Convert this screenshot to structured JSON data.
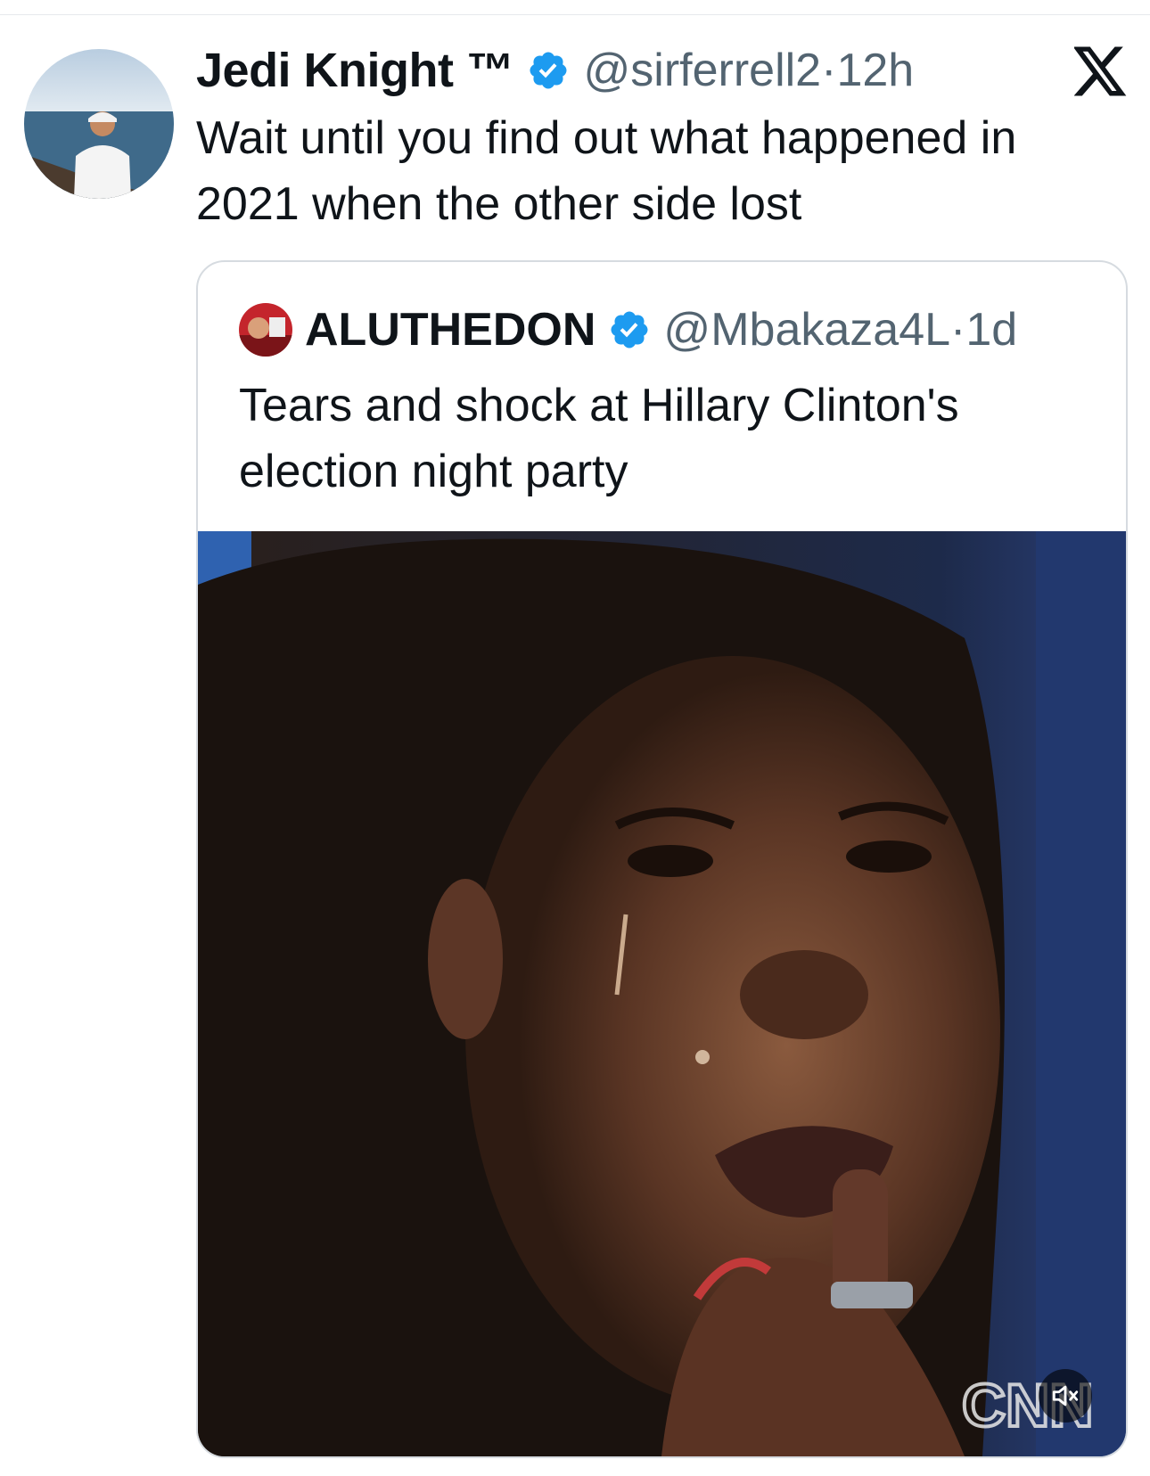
{
  "tweet": {
    "author_name": "Jedi Knight ™",
    "handle": "@sirferrell2",
    "separator": "·",
    "time": "12h",
    "text": "Wait until you find out what happened in 2021 when the other side lost"
  },
  "quoted_tweet": {
    "author_name": "ALUTHEDON",
    "handle": "@Mbakaza4L",
    "separator": "·",
    "time": "1d",
    "text": "Tears and shock at Hillary Clinton's election night party",
    "media": {
      "watermark": "CNN",
      "muted": true
    }
  },
  "colors": {
    "verified": "#1d9bf0",
    "secondary_text": "#536471",
    "border": "#d6dbe0"
  }
}
